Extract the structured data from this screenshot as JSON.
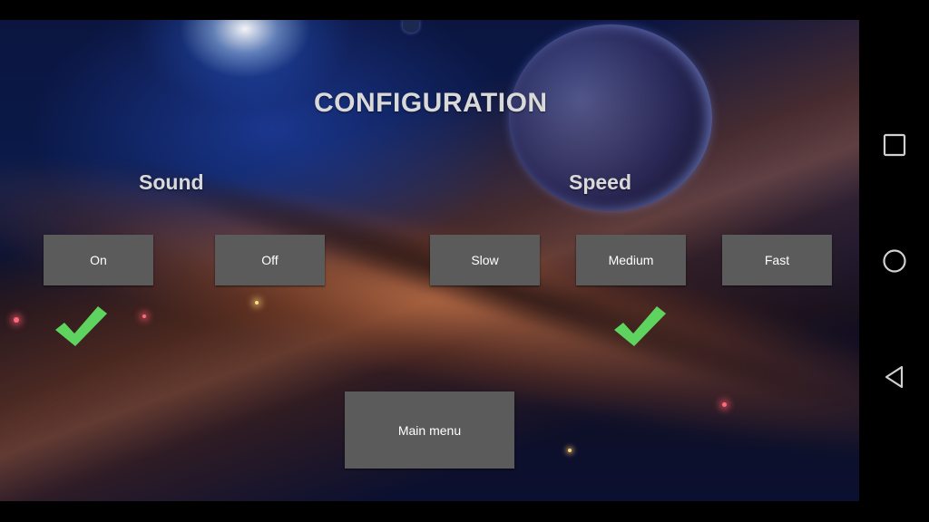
{
  "title": "CONFIGURATION",
  "sound": {
    "label": "Sound",
    "options": [
      "On",
      "Off"
    ],
    "selected": "On"
  },
  "speed": {
    "label": "Speed",
    "options": [
      "Slow",
      "Medium",
      "Fast"
    ],
    "selected": "Medium"
  },
  "main_menu_label": "Main menu",
  "colors": {
    "button_bg": "#5b5b5b",
    "checkmark": "#5fd35f",
    "title_text": "#d9d9d9"
  },
  "nav_icons": [
    "recent-apps-icon",
    "home-icon",
    "back-icon"
  ]
}
